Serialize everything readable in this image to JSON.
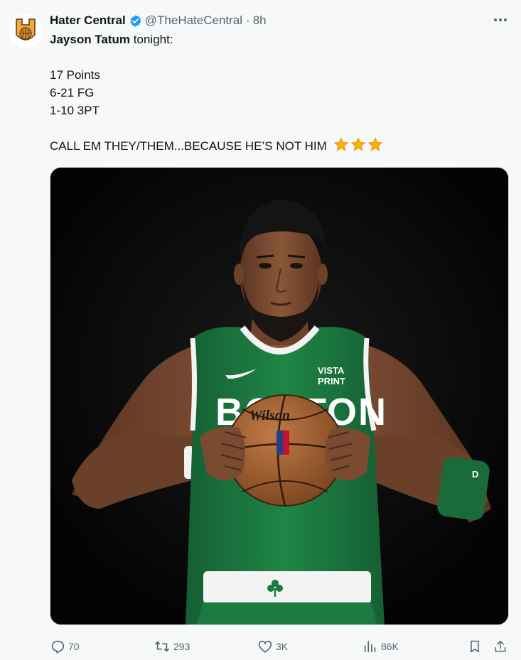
{
  "tweet": {
    "display_name": "Hater Central",
    "handle": "@TheHateCentral",
    "separator": "·",
    "time": "8h",
    "text_name": "Jayson Tatum",
    "text_intro": " tonight:",
    "stats": [
      "17 Points",
      "6-21 FG",
      "1-10 3PT"
    ],
    "closing": "CALL EM THEY/THEM...BECAUSE HE’S NOT HIM",
    "closing_emoji": "star-emoji ×3"
  },
  "media": {
    "jersey_text": "BOSTON",
    "sponsor_line1": "VISTA",
    "sponsor_line2": "PRINT",
    "ball_brand": "Wilson"
  },
  "actions": {
    "replies": "70",
    "reposts": "293",
    "likes": "3K",
    "views": "86K"
  },
  "colors": {
    "verified_blue": "#1d9bf0",
    "secondary_text": "#536471",
    "jersey_green": "#1d7a41",
    "star_gold": "#f4b400"
  },
  "icons": [
    "more-icon",
    "verified-badge-icon",
    "reply-icon",
    "repost-icon",
    "like-icon",
    "views-icon",
    "bookmark-icon",
    "share-icon"
  ]
}
